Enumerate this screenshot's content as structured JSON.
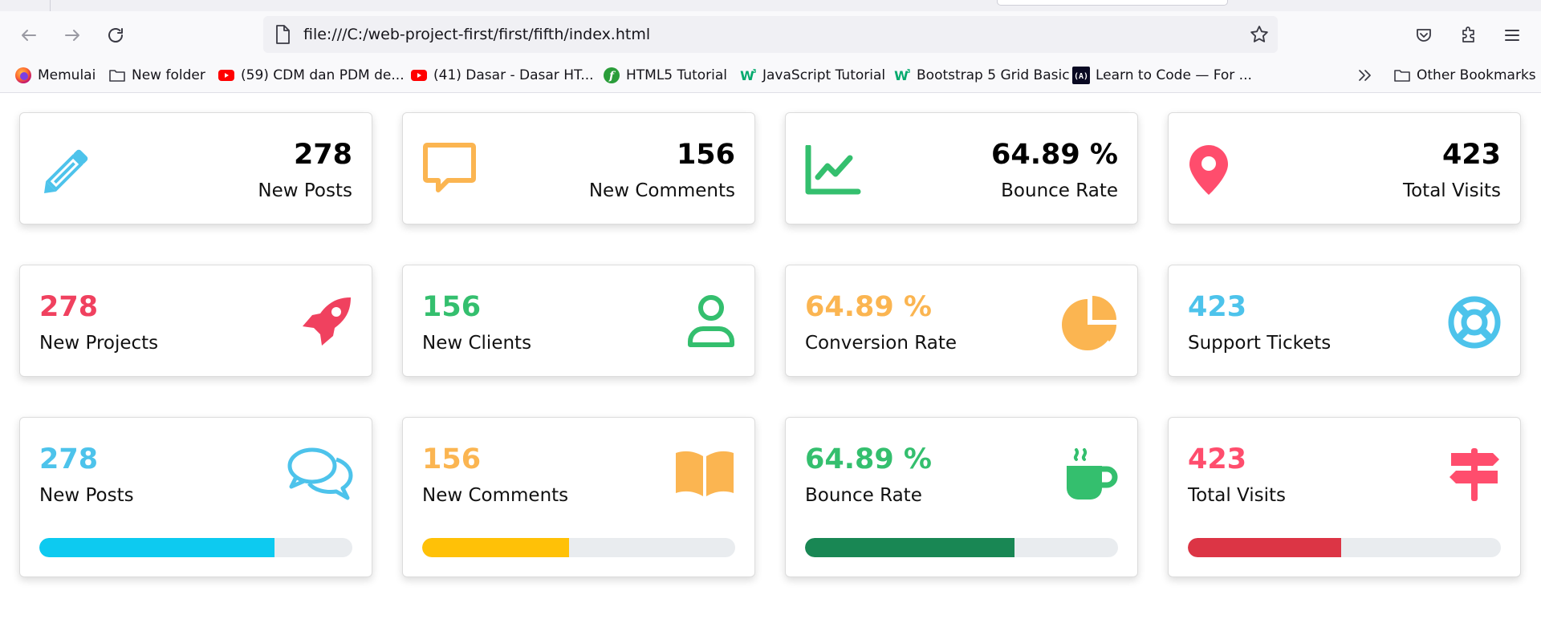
{
  "browser": {
    "url": "file:///C:/web-project-first/first/fifth/index.html"
  },
  "bookmarks": [
    {
      "label": "Memulai",
      "icon": "firefox-icon"
    },
    {
      "label": "New folder",
      "icon": "folder-icon"
    },
    {
      "label": "(59) CDM dan PDM de...",
      "icon": "youtube-icon"
    },
    {
      "label": "(41) Dasar - Dasar HT...",
      "icon": "youtube-icon"
    },
    {
      "label": "HTML5 Tutorial",
      "icon": "tutorial-f-icon"
    },
    {
      "label": "JavaScript Tutorial",
      "icon": "w3schools-icon"
    },
    {
      "label": "Bootstrap 5 Grid Basic",
      "icon": "w3schools-icon"
    },
    {
      "label": "Learn to Code — For ...",
      "icon": "freecodecamp-icon"
    }
  ],
  "other_bookmarks": "Other Bookmarks",
  "cards_row1": [
    {
      "value": "278",
      "label": "New Posts",
      "icon": "pencil-icon",
      "color": "#4dc3eb"
    },
    {
      "value": "156",
      "label": "New Comments",
      "icon": "comment-icon",
      "color": "#fbb551"
    },
    {
      "value": "64.89 %",
      "label": "Bounce Rate",
      "icon": "line-chart-icon",
      "color": "#34bf6e"
    },
    {
      "value": "423",
      "label": "Total Visits",
      "icon": "map-marker-icon",
      "color": "#ff4d6d"
    }
  ],
  "cards_row2": [
    {
      "value": "278",
      "label": "New Projects",
      "icon": "rocket-icon",
      "color": "#f0415f"
    },
    {
      "value": "156",
      "label": "New Clients",
      "icon": "user-icon",
      "color": "#34bf6e"
    },
    {
      "value": "64.89 %",
      "label": "Conversion Rate",
      "icon": "pie-chart-icon",
      "color": "#fbb551"
    },
    {
      "value": "423",
      "label": "Support Tickets",
      "icon": "life-ring-icon",
      "color": "#4dc3eb"
    }
  ],
  "cards_row3": [
    {
      "value": "278",
      "label": "New Posts",
      "icon": "comments-icon",
      "color": "#4dc3eb",
      "progress": 0.75,
      "bar_color": "#0dcaf0"
    },
    {
      "value": "156",
      "label": "New Comments",
      "icon": "book-open-icon",
      "color": "#fbb551",
      "progress": 0.47,
      "bar_color": "#ffc107"
    },
    {
      "value": "64.89 %",
      "label": "Bounce Rate",
      "icon": "coffee-mug-icon",
      "color": "#34bf6e",
      "progress": 0.67,
      "bar_color": "#198754"
    },
    {
      "value": "423",
      "label": "Total Visits",
      "icon": "signpost-icon",
      "color": "#ff4d6d",
      "progress": 0.49,
      "bar_color": "#dc3545"
    }
  ]
}
